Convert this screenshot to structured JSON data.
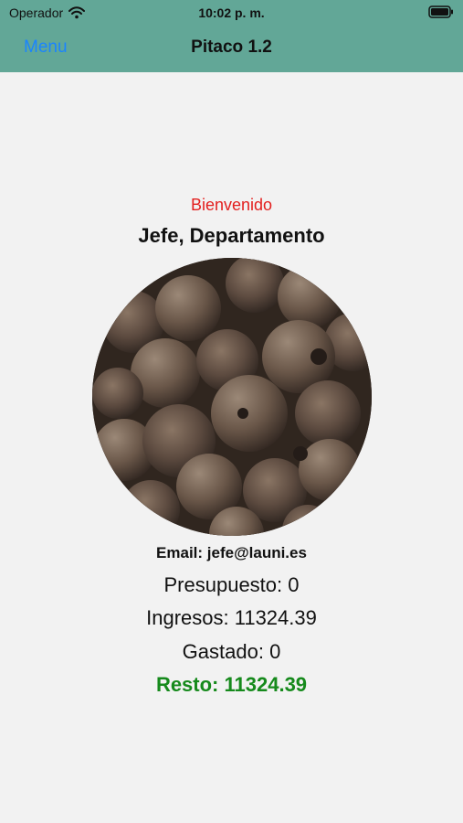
{
  "status_bar": {
    "carrier": "Operador",
    "time": "10:02 p. m."
  },
  "nav": {
    "menu_label": "Menu",
    "title": "Pitaco 1.2"
  },
  "profile": {
    "welcome": "Bienvenido",
    "name": "Jefe, Departamento",
    "email_label": "Email: jefe@launi.es",
    "budget_label": "Presupuesto: 0",
    "income_label": "Ingresos: 11324.39",
    "spent_label": "Gastado: 0",
    "remaining_label": "Resto: 11324.39"
  },
  "colors": {
    "header": "#62a797",
    "accent": "#1a84ff",
    "welcome": "#e3201f",
    "remaining": "#168a1c"
  },
  "icons": {
    "wifi": "wifi-icon",
    "battery": "battery-icon",
    "avatar": "spice-photo"
  }
}
